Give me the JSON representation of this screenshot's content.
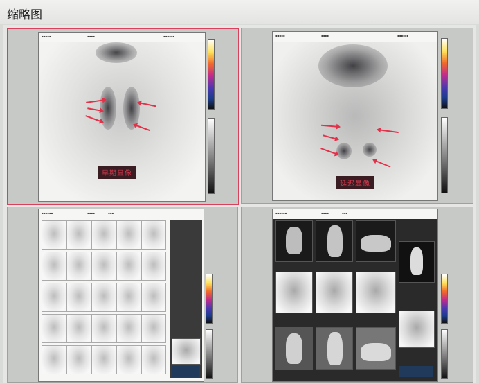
{
  "window": {
    "title": "缩略图"
  },
  "thumbnails": [
    {
      "id": "thumb-1",
      "selected": true,
      "caption": "早期显像"
    },
    {
      "id": "thumb-2",
      "selected": false,
      "caption": "延迟显像"
    },
    {
      "id": "thumb-3",
      "selected": false,
      "caption": ""
    },
    {
      "id": "thumb-4",
      "selected": false,
      "caption": ""
    }
  ],
  "colors": {
    "selection_border": "#d9405c",
    "annotation_arrow": "#e2324a",
    "caption_text": "#d1394e"
  },
  "icons": [
    "color-scale-icon",
    "grayscale-scale-icon"
  ]
}
